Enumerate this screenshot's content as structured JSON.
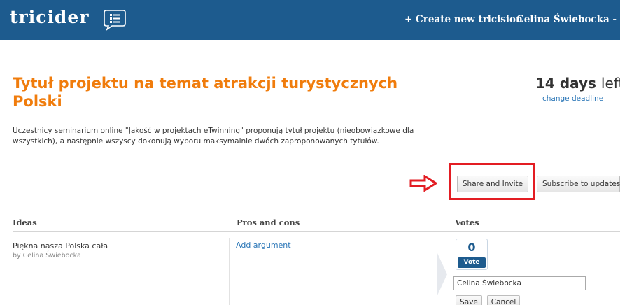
{
  "header": {
    "logo_text": "tricider",
    "logo_icon": "speech-bubble-list-icon",
    "create_link": "+ Create new tricision",
    "user_name": "Celina Świebocka -"
  },
  "tricision": {
    "title": "Tytuł projektu na temat atrakcji turystycznych Polski",
    "days_number": "14",
    "days_unit": "days",
    "days_left": "left",
    "change_deadline": "change deadline",
    "description": "Uczestnicy seminarium online \"Jakość w projektach eTwinning\" proponują tytuł projektu (nieobowiązkowe dla wszystkich), a następnie wszyscy dokonują wyboru maksymalnie dwóch zaproponowanych tytułów."
  },
  "actions": {
    "share_invite": "Share and Invite",
    "subscribe": "Subscribe to updates",
    "annotation_color": "#e31d23"
  },
  "table": {
    "columns": [
      "Ideas",
      "Pros and cons",
      "Votes"
    ],
    "rows": [
      {
        "idea": "Piękna nasza Polska cała",
        "author": "by Celina Świebocka",
        "add_argument": "Add argument",
        "votes": "0",
        "vote_label": "Vote"
      }
    ]
  },
  "vote_form": {
    "name_value": "Celina Świebocka",
    "save": "Save",
    "cancel": "Cancel"
  },
  "colors": {
    "header_bg": "#1d5b8e",
    "title": "#f07c0c",
    "link": "#2a76b7"
  }
}
